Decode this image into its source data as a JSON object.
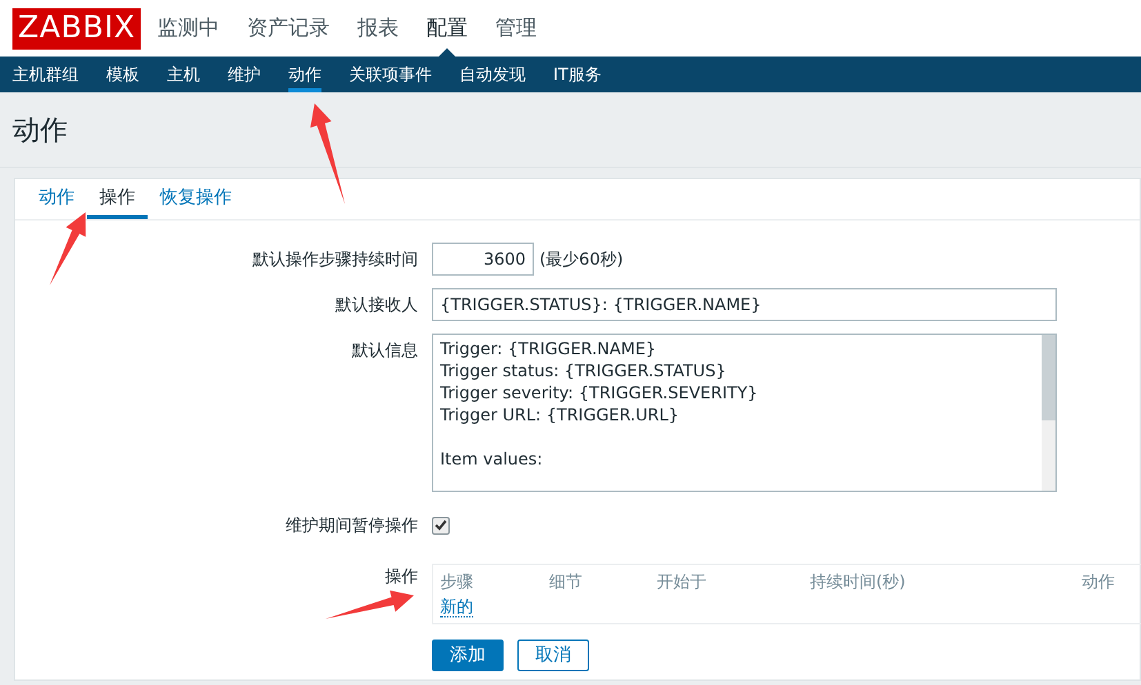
{
  "logo": "ZABBIX",
  "top_menu": [
    {
      "label": "监测中",
      "selected": false
    },
    {
      "label": "资产记录",
      "selected": false
    },
    {
      "label": "报表",
      "selected": false
    },
    {
      "label": "配置",
      "selected": true
    },
    {
      "label": "管理",
      "selected": false
    }
  ],
  "sub_menu": [
    {
      "label": "主机群组",
      "selected": false
    },
    {
      "label": "模板",
      "selected": false
    },
    {
      "label": "主机",
      "selected": false
    },
    {
      "label": "维护",
      "selected": false
    },
    {
      "label": "动作",
      "selected": true
    },
    {
      "label": "关联项事件",
      "selected": false
    },
    {
      "label": "自动发现",
      "selected": false
    },
    {
      "label": "IT服务",
      "selected": false
    }
  ],
  "page_title": "动作",
  "tabs": [
    {
      "label": "动作",
      "selected": false
    },
    {
      "label": "操作",
      "selected": true
    },
    {
      "label": "恢复操作",
      "selected": false
    }
  ],
  "form": {
    "step_duration": {
      "label": "默认操作步骤持续时间",
      "value": "3600",
      "hint": "(最少60秒)"
    },
    "recipient": {
      "label": "默认接收人",
      "value": "{TRIGGER.STATUS}: {TRIGGER.NAME}"
    },
    "message": {
      "label": "默认信息",
      "paragraphs": [
        [
          "Trigger: {TRIGGER.NAME}",
          "Trigger status: {TRIGGER.STATUS}",
          "Trigger severity: {TRIGGER.SEVERITY}",
          "Trigger URL: {TRIGGER.URL}"
        ],
        [
          "Item values:"
        ]
      ]
    },
    "pause": {
      "label": "维护期间暂停操作",
      "checked": true
    },
    "operations": {
      "label": "操作",
      "columns": [
        "步骤",
        "细节",
        "开始于",
        "持续时间(秒)",
        "动作"
      ],
      "new_link": "新的"
    }
  },
  "buttons": [
    {
      "label": "添加",
      "kind": "primary"
    },
    {
      "label": "取消",
      "kind": "secondary"
    }
  ]
}
